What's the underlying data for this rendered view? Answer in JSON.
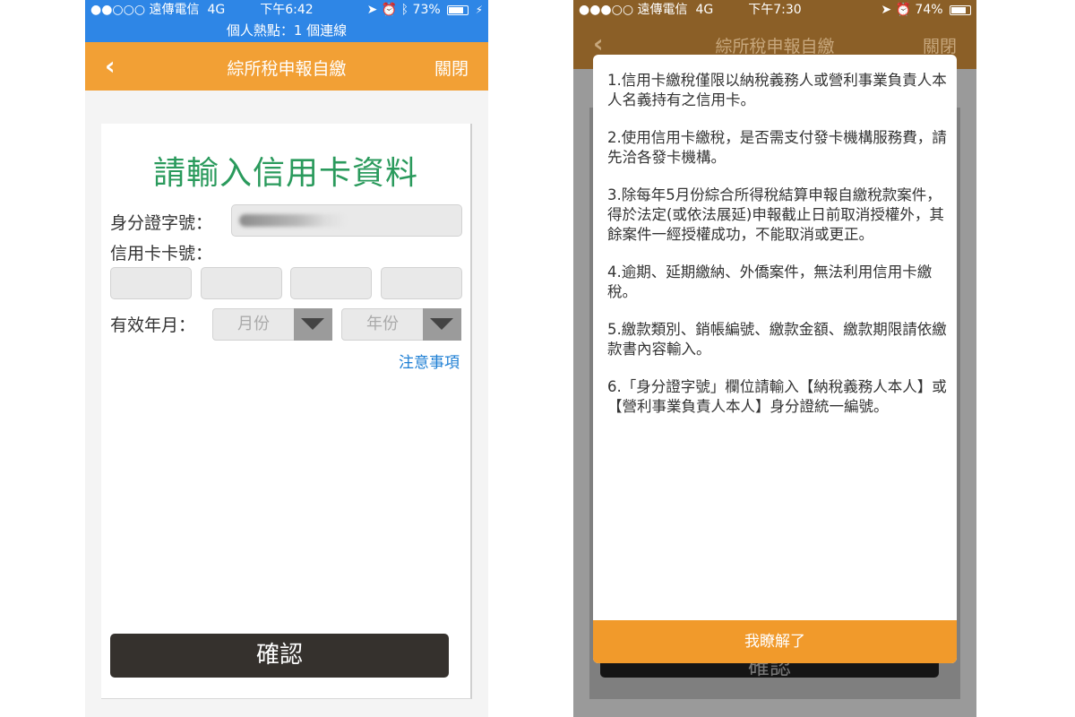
{
  "left": {
    "status": {
      "carrier": "●●○○○ 遠傳電信",
      "network": "4G",
      "time": "下午6:42",
      "battery": "73%"
    },
    "hotspot": "個人熱點：1 個連線",
    "nav": {
      "back": "‹",
      "title": "綜所稅申報自繳",
      "close": "關閉"
    },
    "form": {
      "heading": "請輸入信用卡資料",
      "id_label": "身分證字號：",
      "card_label": "信用卡卡號：",
      "expiry_label": "有效年月：",
      "month_placeholder": "月份",
      "year_placeholder": "年份",
      "notice_link": "注意事項",
      "confirm": "確認"
    }
  },
  "right": {
    "status": {
      "carrier": "●●●○○ 遠傳電信",
      "network": "4G",
      "time": "下午7:30",
      "battery": "74%"
    },
    "nav": {
      "back": "‹",
      "title": "綜所稅申報自繳",
      "close": "關閉"
    },
    "background_button": "確認",
    "notes": [
      "1.信用卡繳稅僅限以納稅義務人或營利事業負責人本人名義持有之信用卡。",
      "2.使用信用卡繳稅，是否需支付發卡機構服務費，請先洽各發卡機構。",
      "3.除每年5月份綜合所得稅結算申報自繳稅款案件，得於法定(或依法展延)申報截止日前取消授權外，其餘案件一經授權成功，不能取消或更正。",
      "4.逾期、延期繳納、外僑案件，無法利用信用卡繳稅。",
      "5.繳款類別、銷帳編號、繳款金額、繳款期限請依繳款書內容輸入。",
      "6.「身分證字號」欄位請輸入【納稅義務人本人】或【營利事業負責人本人】身分證統一編號。"
    ],
    "ack_button": "我瞭解了"
  },
  "colors": {
    "status_blue": "#2e86e6",
    "nav_orange": "#f2a035",
    "heading_green": "#2a9a5c",
    "link_blue": "#1e7fd4",
    "ack_orange": "#f19a2b"
  }
}
